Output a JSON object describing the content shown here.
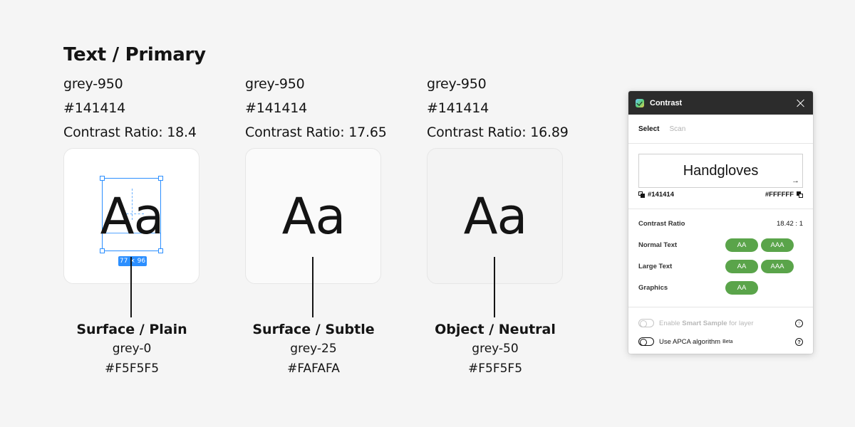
{
  "page": {
    "title": "Text / Primary"
  },
  "columns": [
    {
      "token": "grey-950",
      "hex": "#141414",
      "ratio": "Contrast Ratio: 18.4",
      "sample": "Aa",
      "card_bg": "#ffffff",
      "surface_title": "Surface / Plain",
      "surface_token": "grey-0",
      "surface_hex": "#F5F5F5",
      "selection_size": "77 × 96"
    },
    {
      "token": "grey-950",
      "hex": "#141414",
      "ratio": "Contrast Ratio: 17.65",
      "sample": "Aa",
      "card_bg": "#fafafa",
      "surface_title": "Surface / Subtle",
      "surface_token": "grey-25",
      "surface_hex": "#FAFAFA"
    },
    {
      "token": "grey-950",
      "hex": "#141414",
      "ratio": "Contrast Ratio: 16.89",
      "sample": "Aa",
      "card_bg": "#f5f5f5",
      "surface_title": "Object / Neutral",
      "surface_token": "grey-50",
      "surface_hex": "#F5F5F5"
    }
  ],
  "plugin": {
    "title": "Contrast",
    "tabs": {
      "select": "Select",
      "scan": "Scan"
    },
    "preview_text": "Handgloves",
    "foreground": "#141414",
    "background": "#FFFFFF",
    "contrast_label": "Contrast Ratio",
    "contrast_value": "18.42 : 1",
    "rows": {
      "normal": {
        "label": "Normal Text",
        "aa": "AA",
        "aaa": "AAA"
      },
      "large": {
        "label": "Large Text",
        "aa": "AA",
        "aaa": "AAA"
      },
      "graphics": {
        "label": "Graphics",
        "aa": "AA"
      }
    },
    "smart_sample": {
      "prefix": "Enable",
      "bold": "Smart Sample",
      "suffix": "for layer"
    },
    "apca": {
      "label": "Use APCA algorithm",
      "badge": "Beta"
    },
    "pass_color": "#5aa44a",
    "header_color": "#2c2c2c"
  }
}
